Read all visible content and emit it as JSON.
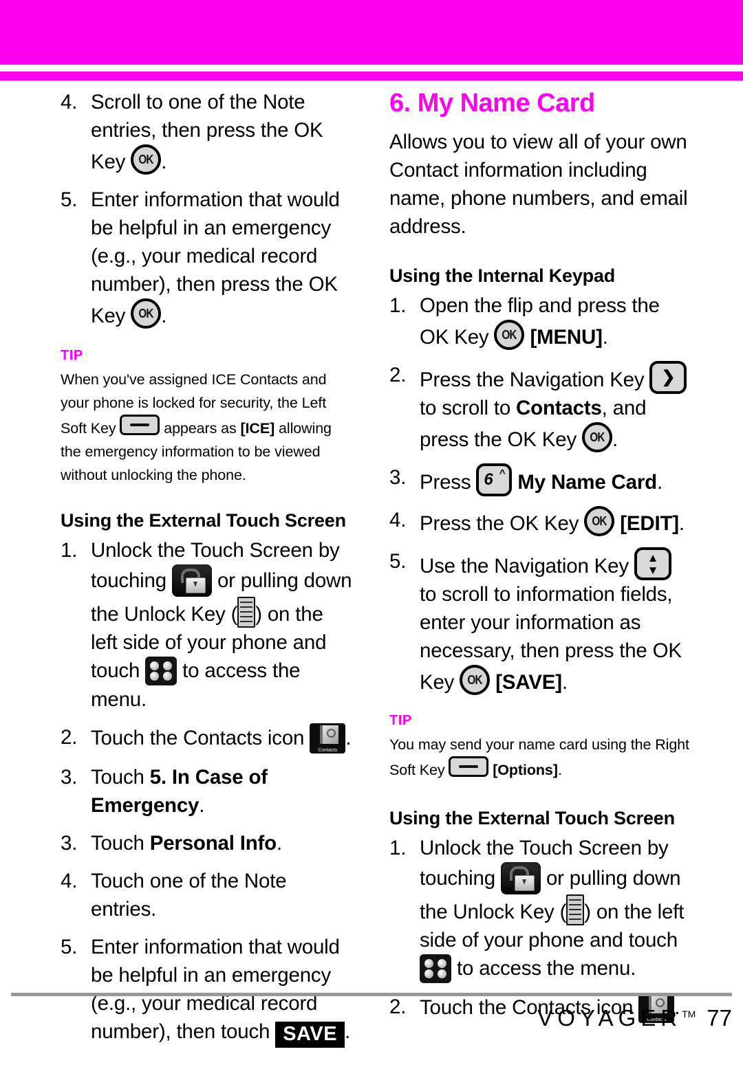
{
  "colors": {
    "accent": "#ff00f0",
    "text": "#000000",
    "footer_rule": "#9a9a9a"
  },
  "banner": {
    "name": "top-magenta-banner"
  },
  "left_column": {
    "steps_top": [
      {
        "num": "4.",
        "text_before": "Scroll to one of the Note entries, then press the OK Key",
        "icon": "ok-key",
        "text_after": "."
      },
      {
        "num": "5.",
        "text_before": "Enter information that would be helpful in an emergency (e.g., your medical record number), then press the OK Key",
        "icon": "ok-key",
        "text_after": "."
      }
    ],
    "tip": {
      "label": "TIP",
      "part1": "When you've assigned ICE Contacts and your phone is locked for security, the Left Soft Key",
      "icon": "soft-key",
      "part2": "appears as",
      "bold1": "[ICE]",
      "part3": "allowing the emergency information to be viewed without unlocking the phone."
    },
    "heading": "Using the External Touch Screen",
    "steps": [
      {
        "num": "1.",
        "p1": "Unlock the Touch Screen by touching",
        "icon1": "unlock-touch-icon",
        "p2": "or pulling down the Unlock Key (",
        "icon2": "unlock-key-ridge-icon",
        "p3": ") on the left side of your phone and touch",
        "icon3": "four-dot-menu-icon",
        "p4": "to access the menu."
      },
      {
        "num": "2.",
        "p1": "Touch the Contacts icon",
        "icon1": "contacts-icon",
        "p2": "."
      },
      {
        "num": "3.",
        "p1": "Touch",
        "bold1": "5. In Case of Emergency",
        "p2": "."
      },
      {
        "num": "3.",
        "p1": "Touch",
        "bold1": "Personal Info",
        "p2": "."
      },
      {
        "num": "4.",
        "p1": "Touch one of the Note entries."
      },
      {
        "num": "5.",
        "p1": "Enter information that would be helpful in an emergency (e.g., your medical record number), then touch",
        "button": "SAVE",
        "p2": "."
      }
    ]
  },
  "right_column": {
    "title": "6. My Name Card",
    "intro": "Allows you to view all of your own Contact information including name, phone numbers, and email address.",
    "heading_internal": "Using the Internal Keypad",
    "steps_internal": [
      {
        "num": "1.",
        "p1": "Open the flip and press the OK Key",
        "icon1": "ok-key",
        "bold1": "[MENU]",
        "p2": "."
      },
      {
        "num": "2.",
        "p1": "Press the Navigation Key",
        "icon1": "nav-key-right",
        "p2": "to scroll to",
        "bold1": "Contacts",
        "p3": ", and press the OK Key",
        "icon2": "ok-key",
        "p4": "."
      },
      {
        "num": "3.",
        "p1": "Press",
        "icon1": "digit-key-6",
        "bold1": "My Name Card",
        "p2": "."
      },
      {
        "num": "4.",
        "p1": "Press the OK Key",
        "icon1": "ok-key",
        "bold1": "[EDIT]",
        "p2": "."
      },
      {
        "num": "5.",
        "p1": "Use the Navigation Key",
        "icon1": "nav-key-up-down",
        "p2": "to scroll to information fields, enter your information as necessary, then press the OK Key",
        "icon2": "ok-key",
        "bold1": "[SAVE]",
        "p3": "."
      }
    ],
    "tip": {
      "label": "TIP",
      "part1": "You may send your name card using the Right Soft Key",
      "icon": "soft-key",
      "bold1": "[Options]",
      "part2": "."
    },
    "heading_external": "Using the External Touch Screen",
    "steps_external": [
      {
        "num": "1.",
        "p1": "Unlock the Touch Screen by touching",
        "icon1": "unlock-touch-icon",
        "p2": "or pulling down the Unlock Key (",
        "icon2": "unlock-key-ridge-icon",
        "p3": ") on the left side of your phone and touch",
        "icon3": "four-dot-menu-icon",
        "p4": "to access the menu."
      },
      {
        "num": "2.",
        "p1": "Touch the Contacts icon",
        "icon1": "contacts-icon",
        "p2": "."
      }
    ]
  },
  "footer": {
    "brand": "VOYAGER",
    "tm": "TM",
    "page": "77"
  },
  "keys": {
    "digit_6": "6",
    "digit_6_caret": "^"
  }
}
